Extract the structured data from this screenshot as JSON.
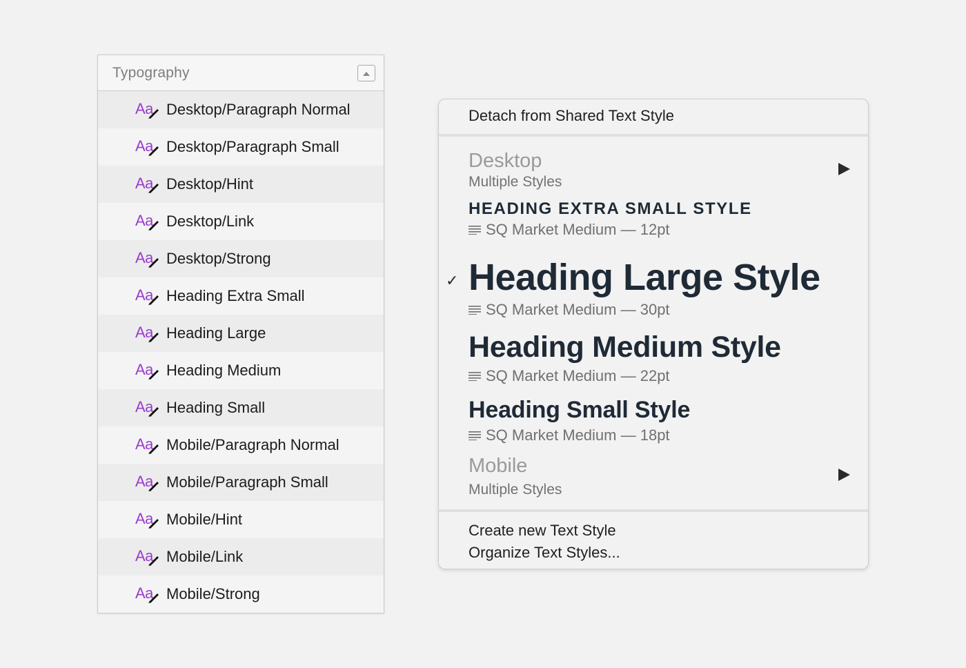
{
  "typography_panel": {
    "title": "Typography",
    "icon_text": "Aa",
    "items": [
      {
        "label": "Desktop/Paragraph Normal"
      },
      {
        "label": "Desktop/Paragraph Small"
      },
      {
        "label": "Desktop/Hint"
      },
      {
        "label": "Desktop/Link"
      },
      {
        "label": "Desktop/Strong"
      },
      {
        "label": "Heading Extra Small"
      },
      {
        "label": "Heading Large"
      },
      {
        "label": "Heading Medium"
      },
      {
        "label": "Heading Small"
      },
      {
        "label": "Mobile/Paragraph Normal"
      },
      {
        "label": "Mobile/Paragraph Small"
      },
      {
        "label": "Mobile/Hint"
      },
      {
        "label": "Mobile/Link"
      },
      {
        "label": "Mobile/Strong"
      }
    ]
  },
  "style_menu": {
    "detach_label": "Detach from Shared Text Style",
    "groups": [
      {
        "title": "Desktop",
        "subtitle": "Multiple Styles"
      },
      {
        "title": "Mobile",
        "subtitle": "Multiple Styles"
      }
    ],
    "styles": [
      {
        "name": "HEADING EXTRA SMALL STYLE",
        "meta": "SQ Market Medium — 12pt",
        "checked": false
      },
      {
        "name": "Heading Large Style",
        "meta": "SQ Market Medium — 30pt",
        "checked": true,
        "check_glyph": "✓"
      },
      {
        "name": "Heading Medium Style",
        "meta": "SQ Market Medium — 22pt",
        "checked": false
      },
      {
        "name": "Heading Small Style",
        "meta": "SQ Market Medium — 18pt",
        "checked": false
      }
    ],
    "create_label": "Create new Text Style",
    "organize_label": "Organize Text Styles..."
  },
  "colors": {
    "aa_icon": "#9a3bd0",
    "style_text": "#1f2a36",
    "group_title": "#9a9a9a"
  },
  "icons": {
    "collapse": "collapse-panel-icon",
    "text_style": "text-style-icon",
    "submenu": "submenu-arrow-icon",
    "paragraph": "paragraph-lines-icon",
    "check": "checkmark-icon"
  }
}
